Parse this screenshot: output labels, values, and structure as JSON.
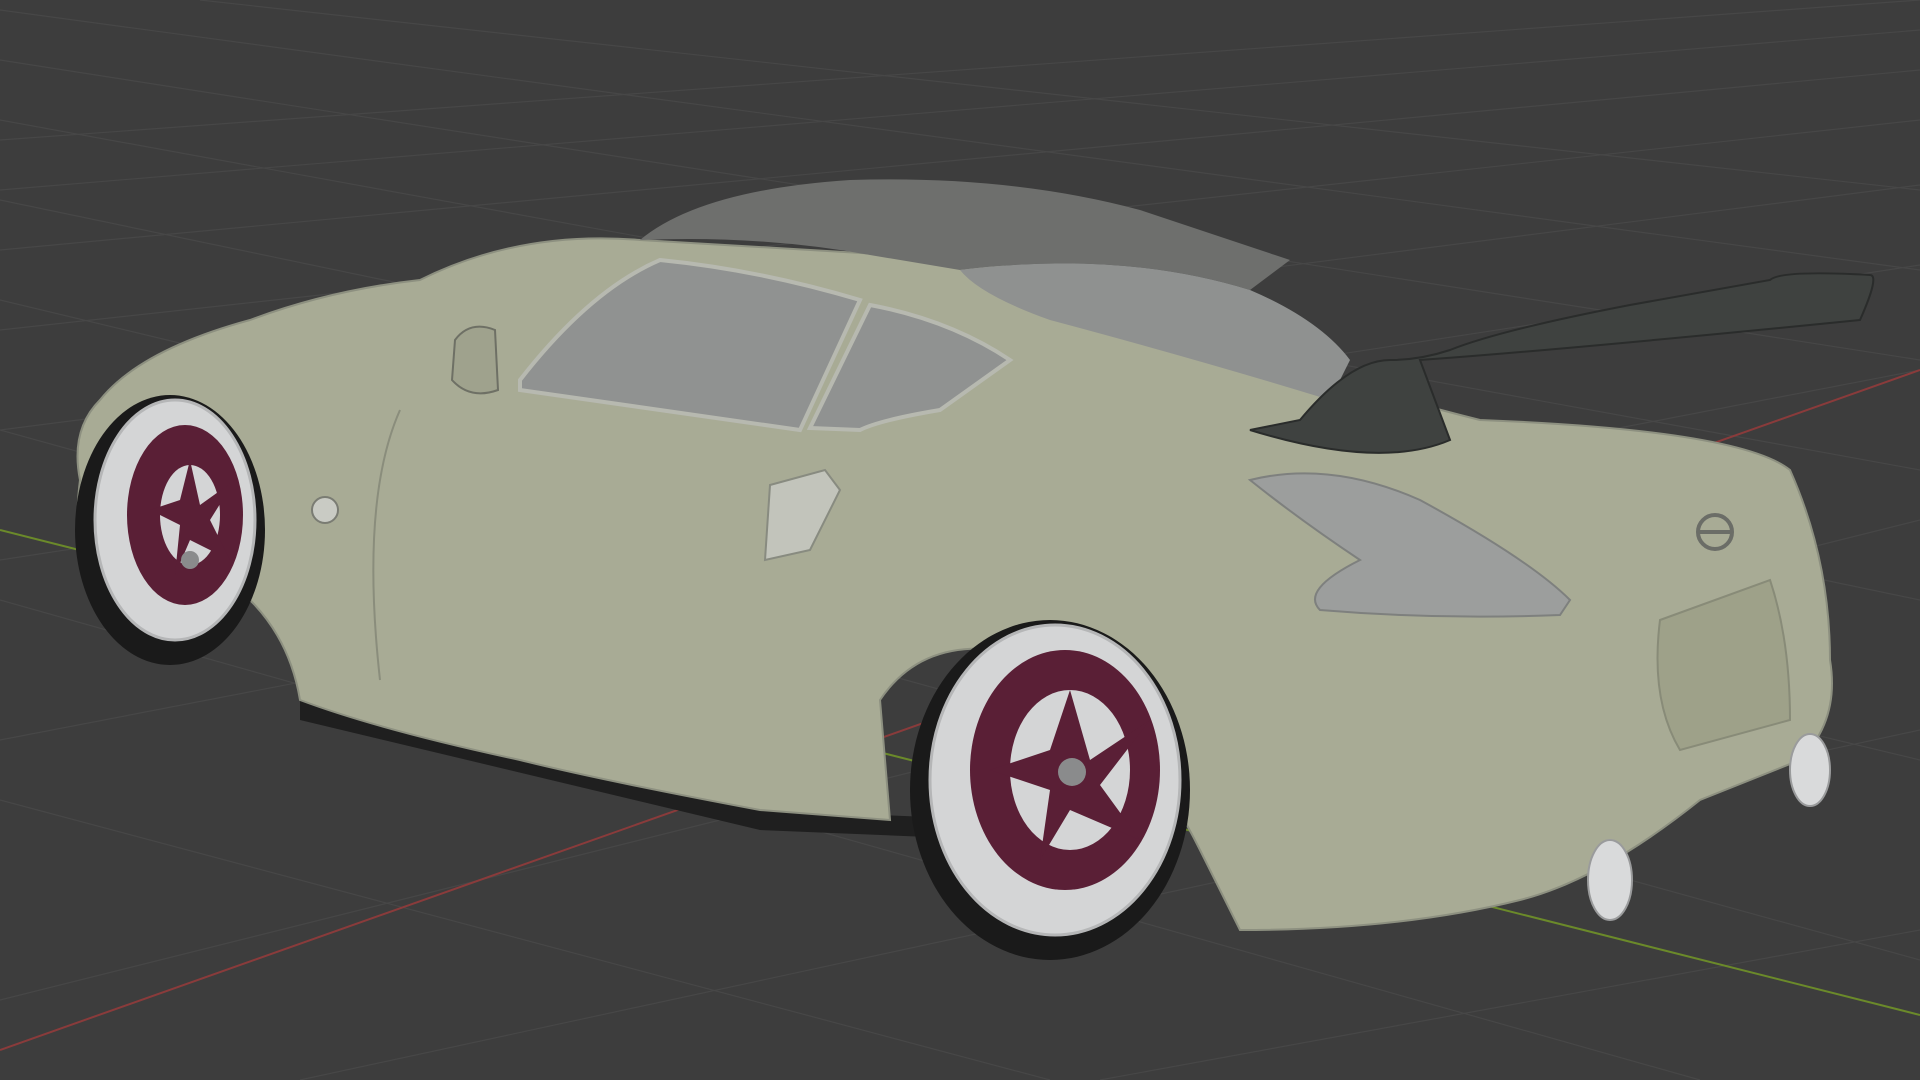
{
  "viewport": {
    "background": "#3d3d3d",
    "grid_color": "#474747",
    "x_axis_color": "#8a3b3b",
    "y_axis_color": "#6b8a2a"
  },
  "model": {
    "body_color": "#a8ab95",
    "roof_color": "#6e6f6d",
    "glass_color": "#8f9190",
    "wing_color": "#3f4240",
    "tail_light_color": "#9c9e9d",
    "rim_barrel_color": "#d4d5d6",
    "rim_face_color": "#5a1f36",
    "tire_color": "#1a1a1a",
    "exhaust_color": "#d9dadb",
    "logo_icon": "nissan-badge-icon",
    "fuel_icon": "z-badge-icon"
  }
}
